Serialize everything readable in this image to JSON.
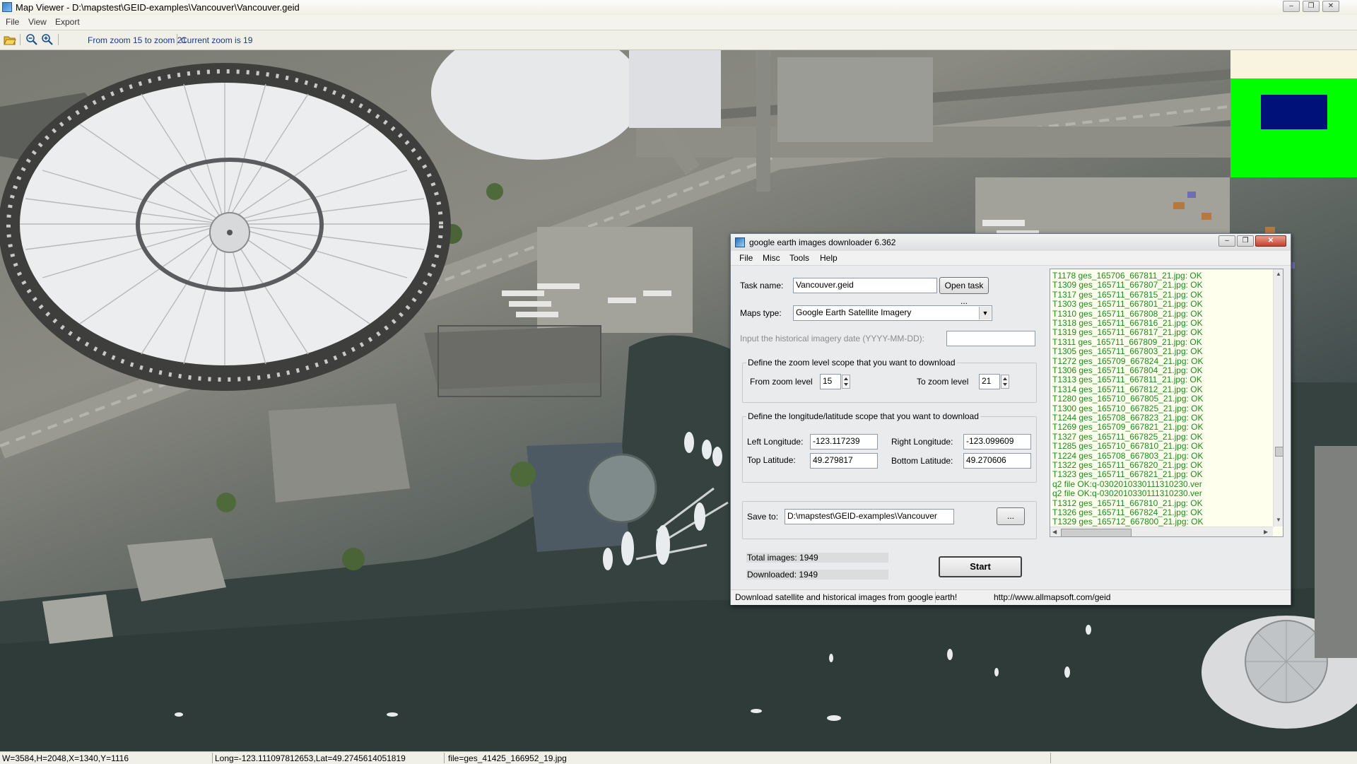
{
  "window": {
    "title": "Map Viewer - D:\\mapstest\\GEID-examples\\Vancouver\\Vancouver.geid",
    "controls": [
      "–",
      "❐",
      "✕"
    ]
  },
  "menu": [
    "File",
    "View",
    "Export"
  ],
  "toolbar": {
    "zoom_range": "From zoom 15 to zoom 21",
    "current_zoom": "Current zoom is 19"
  },
  "statusbar": {
    "size": "W=3584,H=2048,X=1340,Y=1116",
    "coords": "Long=-123.111097812653,Lat=49.2745614051819",
    "file": "file=ges_41425_166952_19.jpg"
  },
  "colors": {
    "minimap_bg": "#f8f4e0",
    "minimap_area": "#00ff00",
    "minimap_view": "#00117a",
    "log_text": "#1c8a1c"
  },
  "dialog": {
    "title": "google earth images downloader 6.362",
    "menu": [
      "File",
      "Misc",
      "Tools",
      "Help"
    ],
    "task_label": "Task name:",
    "task_value": "Vancouver.geid",
    "open_task_btn": "Open task ...",
    "maps_type_label": "Maps type:",
    "maps_type_value": "Google Earth Satellite Imagery",
    "hist_label": "Input the  historical imagery date (YYYY-MM-DD):",
    "hist_value": "",
    "zoom_group": "Define the zoom level scope that you want to download",
    "from_zoom_label": "From zoom level",
    "from_zoom_value": "15",
    "to_zoom_label": "To zoom level",
    "to_zoom_value": "21",
    "lonlat_group": "Define the longitude/latitude scope that you want to download",
    "left_lon_label": "Left Longitude:",
    "left_lon_value": "-123.117239",
    "right_lon_label": "Right Longitude:",
    "right_lon_value": "-123.099609",
    "top_lat_label": "Top Latitude:",
    "top_lat_value": "49.279817",
    "bottom_lat_label": "Bottom Latitude:",
    "bottom_lat_value": "49.270606",
    "save_label": "Save to:",
    "save_value": "D:\\mapstest\\GEID-examples\\Vancouver",
    "browse_btn": "...",
    "total_images": "Total images: 1949",
    "downloaded": "Downloaded: 1949",
    "start_btn": "Start",
    "status_left": "Download satellite and historical  images from google earth!",
    "status_right": "http://www.allmapsoft.com/geid",
    "log": [
      "T1178 ges_165706_667811_21.jpg:  OK",
      "T1309 ges_165711_667807_21.jpg:  OK",
      "T1317 ges_165711_667815_21.jpg:  OK",
      "T1303 ges_165711_667801_21.jpg:  OK",
      "T1310 ges_165711_667808_21.jpg:  OK",
      "T1318 ges_165711_667816_21.jpg:  OK",
      "T1319 ges_165711_667817_21.jpg:  OK",
      "T1311 ges_165711_667809_21.jpg:  OK",
      "T1305 ges_165711_667803_21.jpg:  OK",
      "T1272 ges_165709_667824_21.jpg:  OK",
      "T1306 ges_165711_667804_21.jpg:  OK",
      "T1313 ges_165711_667811_21.jpg:  OK",
      "T1314 ges_165711_667812_21.jpg:  OK",
      "T1280 ges_165710_667805_21.jpg:  OK",
      "T1300 ges_165710_667825_21.jpg:  OK",
      "T1244 ges_165708_667823_21.jpg:  OK",
      "T1269 ges_165709_667821_21.jpg:  OK",
      "T1327 ges_165711_667825_21.jpg:  OK",
      "T1285 ges_165710_667810_21.jpg:  OK",
      "T1224 ges_165708_667803_21.jpg:  OK",
      "T1322 ges_165711_667820_21.jpg:  OK",
      "T1323 ges_165711_667821_21.jpg:  OK",
      "q2 file OK:q-0302010330111310230.ver",
      "q2 file OK:q-0302010330111310230.ver",
      "T1312 ges_165711_667810_21.jpg:  OK",
      "T1326 ges_165711_667824_21.jpg:  OK",
      "T1329 ges_165712_667800_21.jpg:  OK"
    ]
  }
}
